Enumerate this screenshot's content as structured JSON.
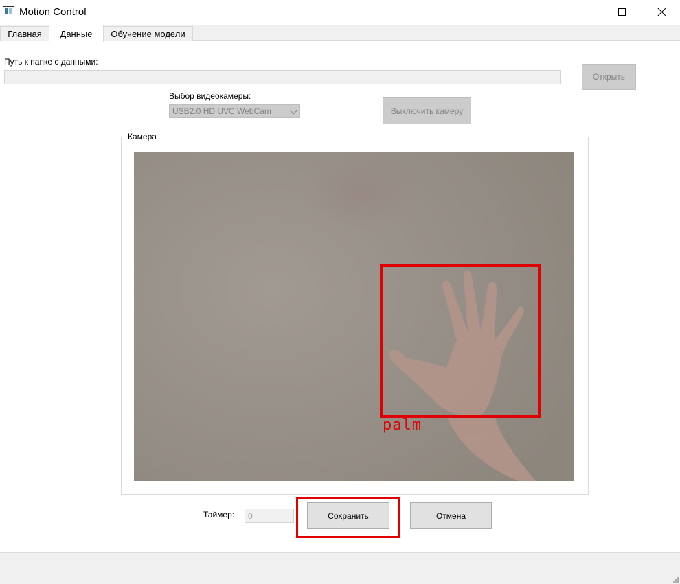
{
  "window": {
    "title": "Motion Control"
  },
  "tabs": [
    {
      "label": "Главная",
      "active": false
    },
    {
      "label": "Данные",
      "active": true
    },
    {
      "label": "Обучение модели",
      "active": false
    }
  ],
  "data_folder": {
    "label": "Путь к папке с данными:",
    "value": "",
    "open_button": "Открыть"
  },
  "camera_select": {
    "label": "Выбор видеокамеры:",
    "selected": "USB2.0 HD UVC WebCam",
    "toggle_button": "Выключить камеру"
  },
  "camera_group": {
    "title": "Камера",
    "detection_label": "palm"
  },
  "timer": {
    "label": "Таймер:",
    "value": "0"
  },
  "actions": {
    "save": "Сохранить",
    "cancel": "Отмена"
  },
  "colors": {
    "detection": "#e00000",
    "disabled_button": "#cccccc"
  }
}
